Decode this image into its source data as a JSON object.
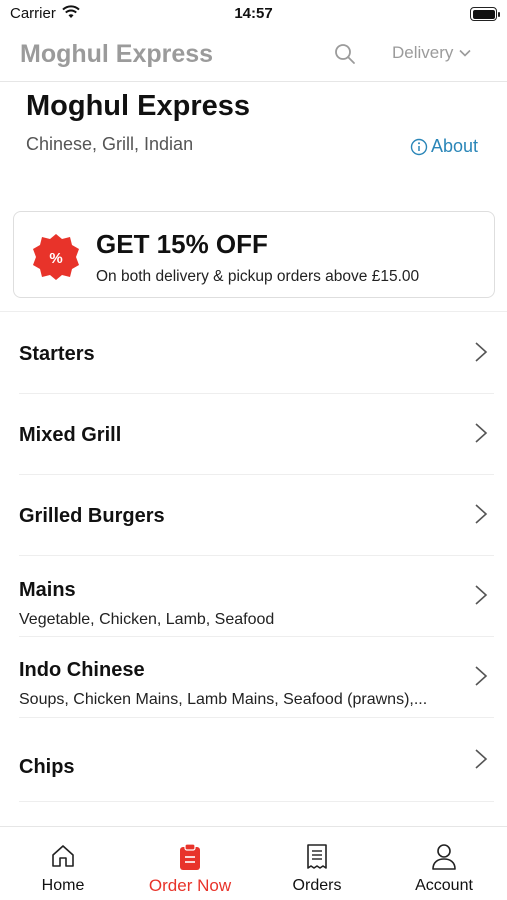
{
  "status_bar": {
    "carrier": "Carrier",
    "time": "14:57"
  },
  "nav": {
    "title": "Moghul Express",
    "delivery_label": "Delivery"
  },
  "restaurant": {
    "name": "Moghul Express",
    "cuisines": "Chinese, Grill, Indian",
    "about_label": "About"
  },
  "promo": {
    "title": "GET 15% OFF",
    "subtitle": "On both delivery & pickup orders above £15.00",
    "badge_symbol": "%"
  },
  "menu": {
    "items": [
      {
        "title": "Starters",
        "subtitle": ""
      },
      {
        "title": "Mixed Grill",
        "subtitle": ""
      },
      {
        "title": "Grilled Burgers",
        "subtitle": ""
      },
      {
        "title": "Mains",
        "subtitle": "Vegetable, Chicken, Lamb, Seafood"
      },
      {
        "title": "Indo Chinese",
        "subtitle": "Soups, Chicken Mains, Lamb Mains, Seafood (prawns),..."
      },
      {
        "title": "Chips",
        "subtitle": ""
      }
    ]
  },
  "tabs": [
    {
      "label": "Home",
      "icon": "home-icon"
    },
    {
      "label": "Order Now",
      "icon": "order-bag-icon",
      "active": true
    },
    {
      "label": "Orders",
      "icon": "receipt-icon"
    },
    {
      "label": "Account",
      "icon": "person-icon"
    }
  ],
  "colors": {
    "accent": "#e8332a",
    "link": "#2a86b8",
    "muted": "#9b9b9b"
  }
}
